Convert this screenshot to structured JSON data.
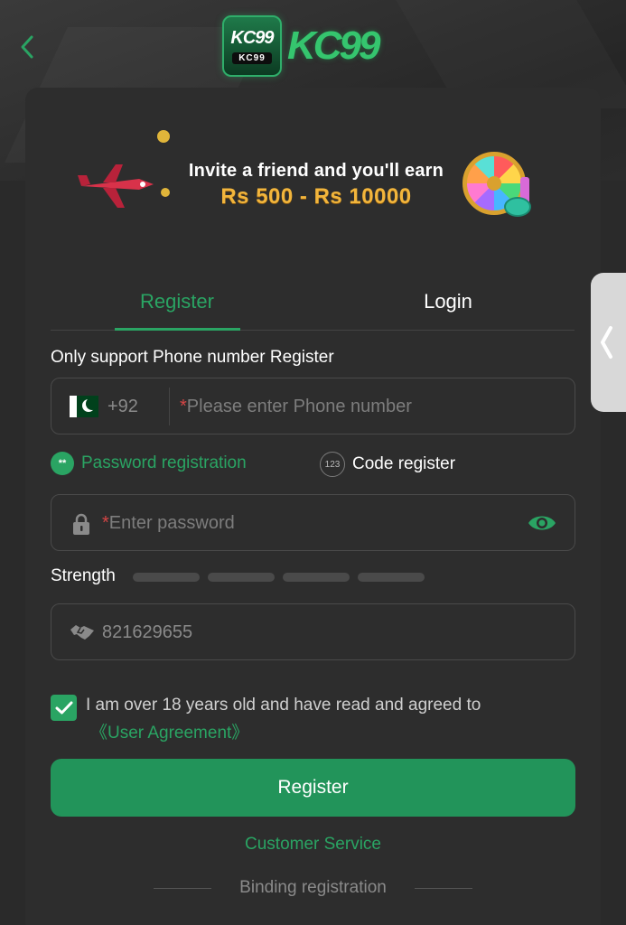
{
  "header": {
    "logo_badge_top": "KC99",
    "logo_badge_bottom": "KC99",
    "logo_text": "KC99"
  },
  "banner": {
    "line1": "Invite a friend and you'll earn",
    "line2": "Rs 500 - Rs 10000"
  },
  "tabs": [
    {
      "label": "Register",
      "active": true
    },
    {
      "label": "Login",
      "active": false
    }
  ],
  "form": {
    "hint": "Only support Phone number Register",
    "country_code": "+92",
    "phone_required_mark": "*",
    "phone_placeholder": "Please enter Phone number",
    "option_password": {
      "label": "Password registration",
      "icon_text": "**",
      "selected": true
    },
    "option_code": {
      "label": "Code register",
      "icon_text": "123",
      "selected": false
    },
    "password_required_mark": "*",
    "password_placeholder": "Enter password",
    "strength_label": "Strength",
    "strength_level": 0,
    "invite_code": "821629655",
    "agree_checked": true,
    "agree_text": "I am over 18 years old and have read and agreed to",
    "agree_link": "《User Agreement》",
    "register_button": "Register",
    "customer_service": "Customer Service",
    "binding_registration": "Binding registration"
  },
  "colors": {
    "accent": "#2aa463",
    "button": "#22945a",
    "background": "#2a2a2a",
    "card": "#2d2d2d",
    "required": "#d64545"
  },
  "icons": {
    "back": "chevron-left-icon",
    "side_handle": "chevron-left-icon",
    "lock": "lock-icon",
    "eye": "eye-icon",
    "invite": "handshake-icon",
    "checkbox": "checkmark-icon",
    "flag": "pakistan-flag-icon"
  }
}
